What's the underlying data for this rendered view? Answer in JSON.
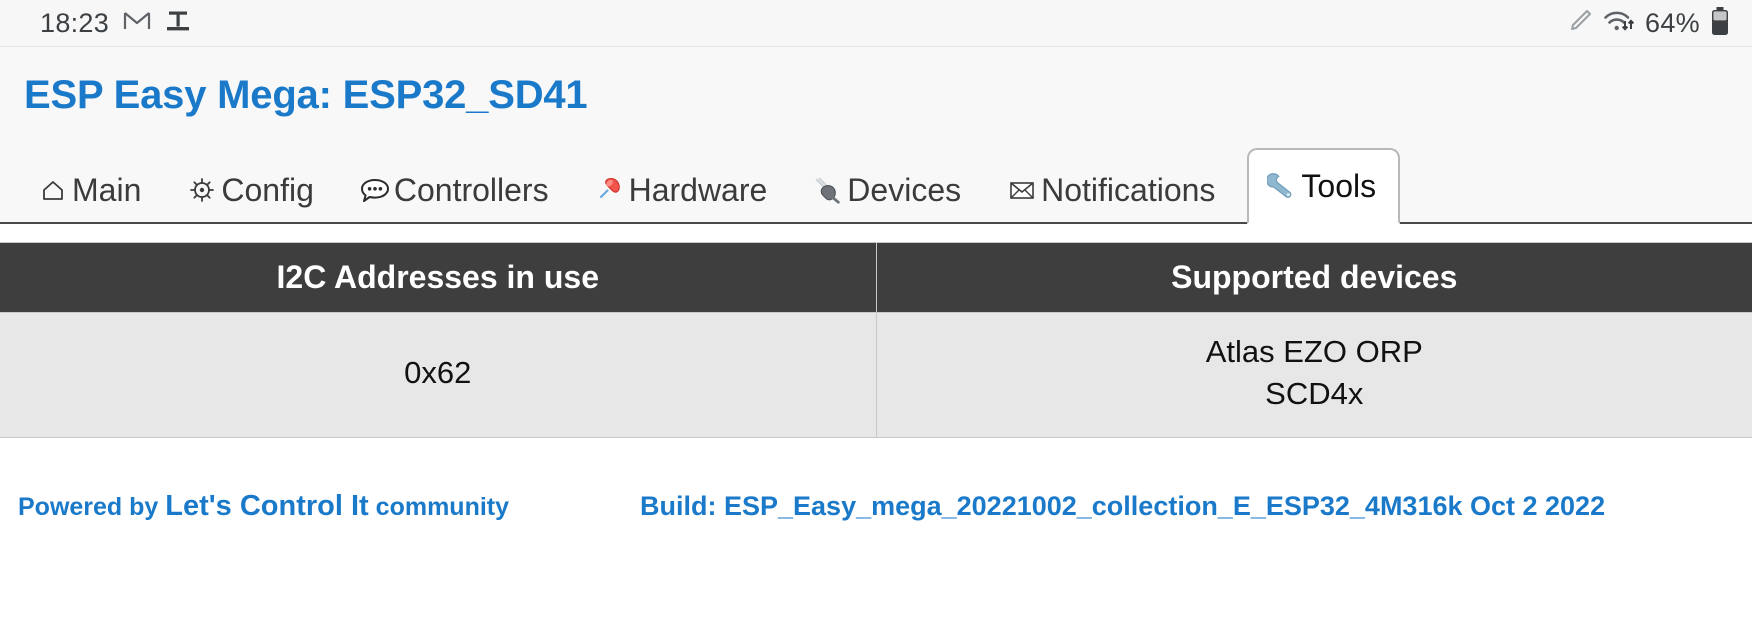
{
  "status_bar": {
    "clock": "18:23",
    "icons_left": [
      "gmail-icon",
      "app-icon"
    ],
    "icons_right": [
      "pencil-icon",
      "wifi-transfer-icon"
    ],
    "battery_percent": "64%",
    "battery_icon": "battery-icon"
  },
  "header": {
    "title": "ESP Easy Mega: ESP32_SD41",
    "title_color": "#1a7ac9"
  },
  "tabs": [
    {
      "label": "Main",
      "icon": "home-icon",
      "glyph": "⌂",
      "active": false
    },
    {
      "label": "Config",
      "icon": "gear-icon",
      "glyph": "⚙",
      "active": false
    },
    {
      "label": "Controllers",
      "icon": "speech-bubble-icon",
      "glyph": "💬",
      "active": false
    },
    {
      "label": "Hardware",
      "icon": "pushpin-icon",
      "glyph": "📌",
      "active": false
    },
    {
      "label": "Devices",
      "icon": "plug-icon",
      "glyph": "🔌",
      "active": false
    },
    {
      "label": "Notifications",
      "icon": "envelope-icon",
      "glyph": "✉",
      "active": false
    },
    {
      "label": "Tools",
      "icon": "wrench-icon",
      "glyph": "🔧",
      "active": true
    }
  ],
  "table": {
    "headers": [
      "I2C Addresses in use",
      "Supported devices"
    ],
    "rows": [
      {
        "address": "0x62",
        "devices": [
          "Atlas EZO ORP",
          "SCD4x"
        ]
      }
    ]
  },
  "footer": {
    "powered_prefix": "Powered by ",
    "powered_link": "Let's Control It",
    "powered_suffix": " community",
    "build": "Build: ESP_Easy_mega_20221002_collection_E_ESP32_4M316k Oct 2 2022"
  }
}
